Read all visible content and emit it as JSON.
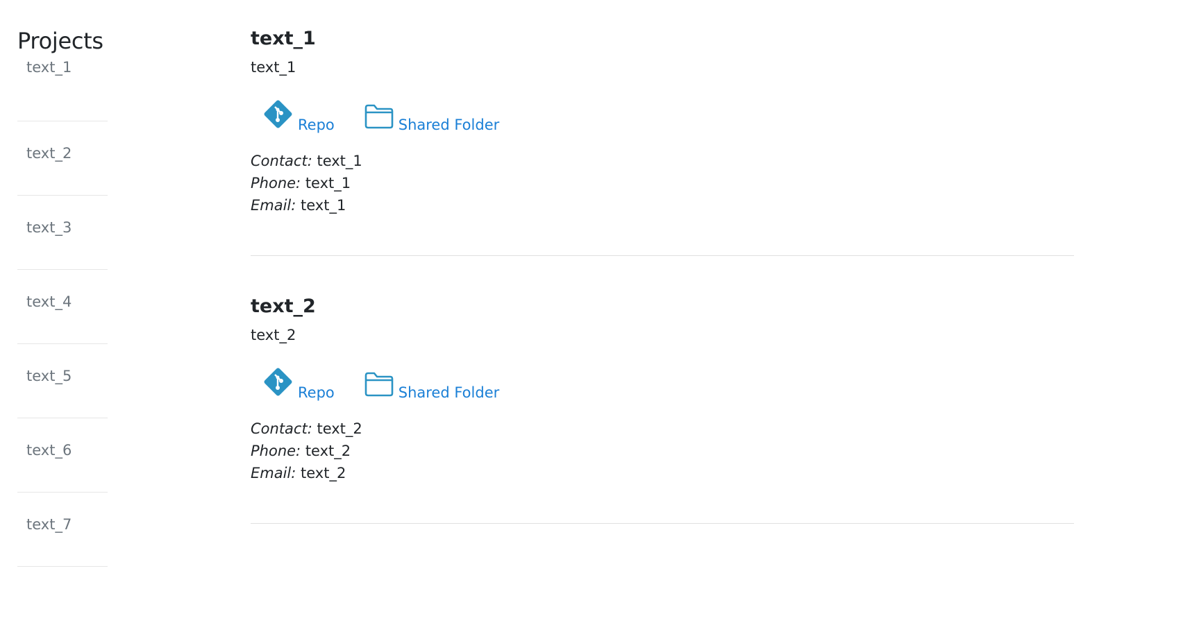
{
  "sidebar": {
    "title": "Projects",
    "items": [
      {
        "label": "text_1"
      },
      {
        "label": "text_2"
      },
      {
        "label": "text_3"
      },
      {
        "label": "text_4"
      },
      {
        "label": "text_5"
      },
      {
        "label": "text_6"
      },
      {
        "label": "text_7"
      }
    ]
  },
  "projects": [
    {
      "title": "text_1",
      "description": "text_1",
      "repo_label": "Repo",
      "folder_label": "Shared Folder",
      "contact_label": "Contact:",
      "contact_value": " text_1",
      "phone_label": "Phone:",
      "phone_value": " text_1",
      "email_label": "Email:",
      "email_value": " text_1"
    },
    {
      "title": "text_2",
      "description": "text_2",
      "repo_label": "Repo",
      "folder_label": "Shared Folder",
      "contact_label": "Contact:",
      "contact_value": " text_2",
      "phone_label": "Phone:",
      "phone_value": " text_2",
      "email_label": "Email:",
      "email_value": " text_2"
    }
  ],
  "icons": {
    "repo": "git-icon",
    "folder": "folder-icon"
  },
  "colors": {
    "link": "#1a7fd6",
    "icon": "#2a93c4",
    "sidebar_text": "#6c757d",
    "divider": "#e0e0e0"
  }
}
